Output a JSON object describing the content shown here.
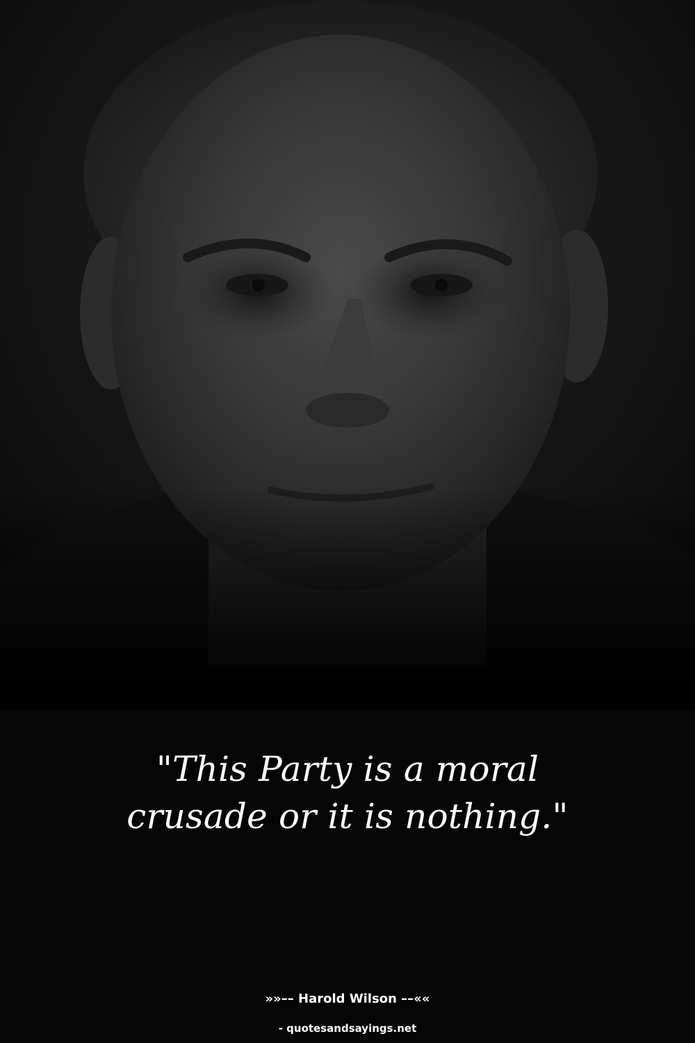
{
  "quote": {
    "text": "\"This Party is a moral crusade or it is nothing.\""
  },
  "attribution": {
    "author_line": "»»–– Harold Wilson ––««",
    "source": "- quotesandsayings.net"
  },
  "colors": {
    "background": "#000000",
    "text": "#ffffff"
  }
}
